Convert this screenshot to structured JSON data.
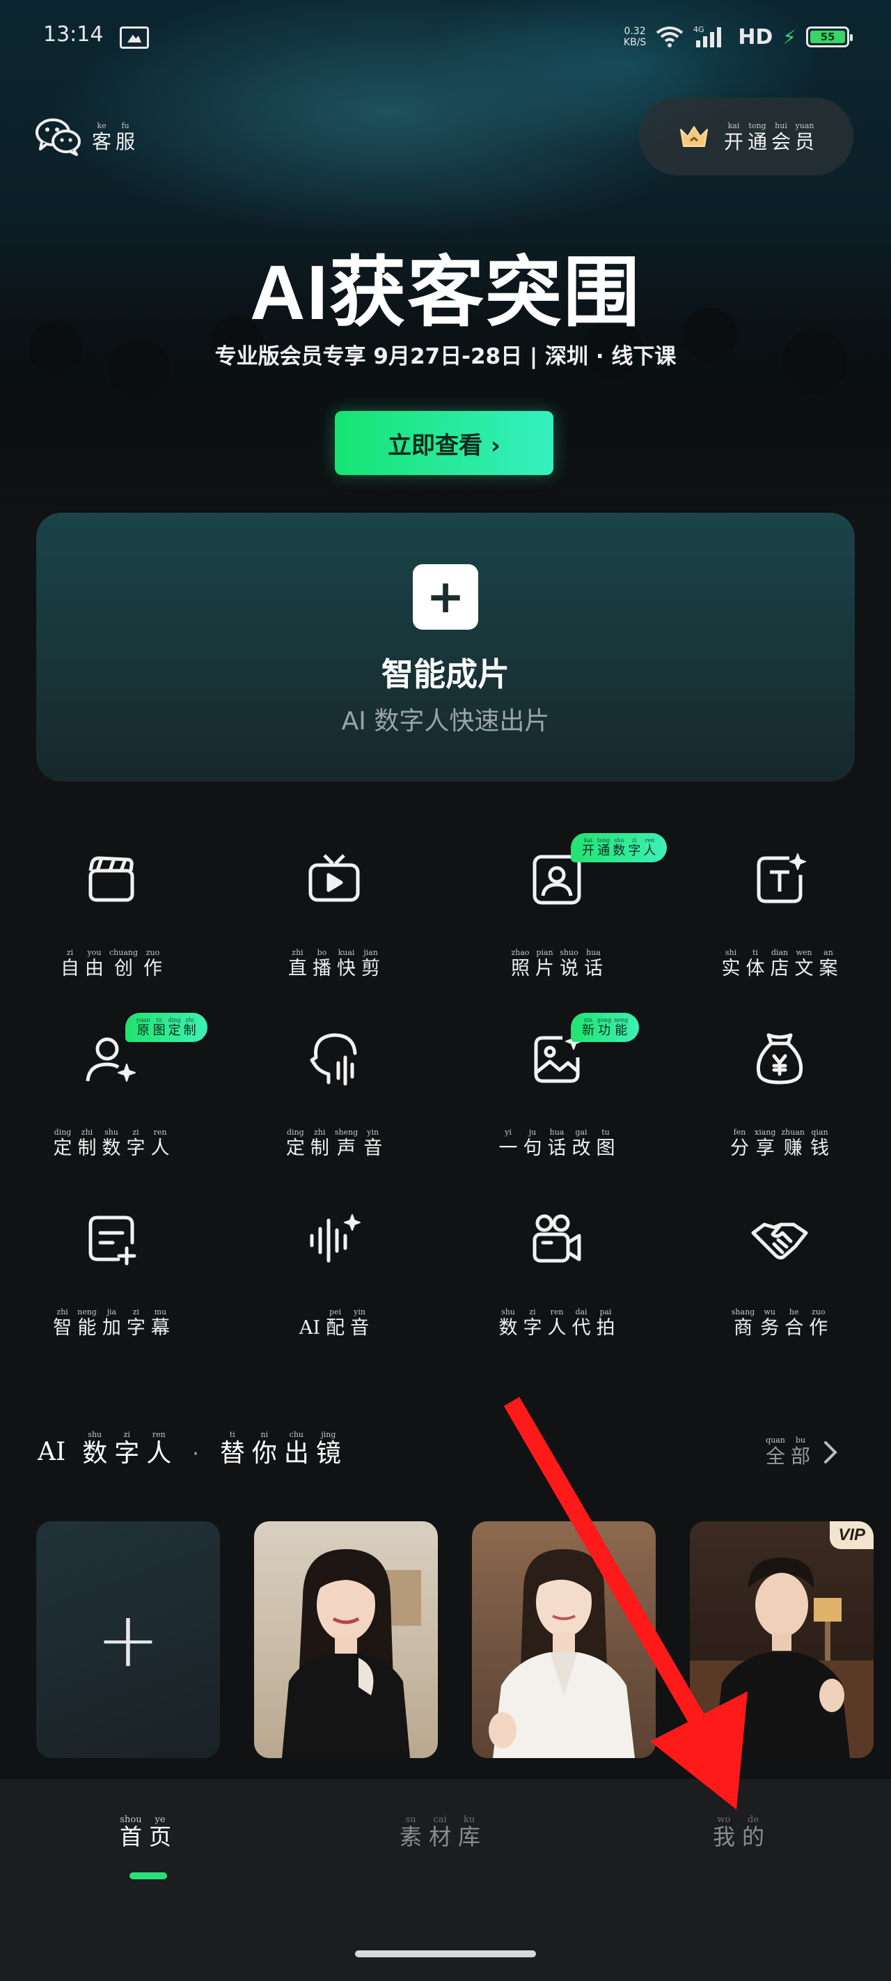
{
  "status_bar": {
    "time": "13:14",
    "net_speed_value": "0.32",
    "net_speed_unit": "KB/S",
    "network": "4G",
    "hd": "HD",
    "battery": "55"
  },
  "header": {
    "service": [
      {
        "py": "ke",
        "hz": "客"
      },
      {
        "py": "fu",
        "hz": "服"
      }
    ],
    "vip": [
      {
        "py": "kai",
        "hz": "开"
      },
      {
        "py": "tong",
        "hz": "通"
      },
      {
        "py": "hui",
        "hz": "会"
      },
      {
        "py": "yuan",
        "hz": "员"
      }
    ]
  },
  "banner": {
    "title": "AI获客突围",
    "subtitle": "专业版会员专享  9月27日-28日 | 深圳 · 线下课",
    "cta": "立即查看 ›"
  },
  "smart_card": {
    "plus": "+",
    "title": "智能成片",
    "subtitle": "AI 数字人快速出片"
  },
  "tools": [
    {
      "name": "free-create",
      "icon": "clapperboard-icon",
      "label": [
        {
          "py": "zi",
          "hz": "自"
        },
        {
          "py": "you",
          "hz": "由"
        },
        {
          "py": "chuang",
          "hz": "创"
        },
        {
          "py": "zuo",
          "hz": "作"
        }
      ]
    },
    {
      "name": "live-clip",
      "icon": "tv-play-icon",
      "label": [
        {
          "py": "zhi",
          "hz": "直"
        },
        {
          "py": "bo",
          "hz": "播"
        },
        {
          "py": "kuai",
          "hz": "快"
        },
        {
          "py": "jian",
          "hz": "剪"
        }
      ]
    },
    {
      "name": "photo-talk",
      "icon": "portrait-icon",
      "badge": [
        {
          "py": "kai",
          "hz": "开"
        },
        {
          "py": "tong",
          "hz": "通"
        },
        {
          "py": "shu",
          "hz": "数"
        },
        {
          "py": "zi",
          "hz": "字"
        },
        {
          "py": "ren",
          "hz": "人"
        }
      ],
      "label": [
        {
          "py": "zhao",
          "hz": "照"
        },
        {
          "py": "pian",
          "hz": "片"
        },
        {
          "py": "shuo",
          "hz": "说"
        },
        {
          "py": "hua",
          "hz": "话"
        }
      ]
    },
    {
      "name": "store-copy",
      "icon": "text-sparkle-icon",
      "label": [
        {
          "py": "shi",
          "hz": "实"
        },
        {
          "py": "ti",
          "hz": "体"
        },
        {
          "py": "dian",
          "hz": "店"
        },
        {
          "py": "wen",
          "hz": "文"
        },
        {
          "py": "an",
          "hz": "案"
        }
      ]
    },
    {
      "name": "custom-avatar",
      "icon": "user-sparkle-icon",
      "badge": [
        {
          "py": "yuan",
          "hz": "原"
        },
        {
          "py": "tu",
          "hz": "图"
        },
        {
          "py": "ding",
          "hz": "定"
        },
        {
          "py": "zhi",
          "hz": "制"
        }
      ],
      "label": [
        {
          "py": "ding",
          "hz": "定"
        },
        {
          "py": "zhi",
          "hz": "制"
        },
        {
          "py": "shu",
          "hz": "数"
        },
        {
          "py": "zi",
          "hz": "字"
        },
        {
          "py": "ren",
          "hz": "人"
        }
      ]
    },
    {
      "name": "custom-voice",
      "icon": "voice-head-icon",
      "label": [
        {
          "py": "ding",
          "hz": "定"
        },
        {
          "py": "zhi",
          "hz": "制"
        },
        {
          "py": "sheng",
          "hz": "声"
        },
        {
          "py": "yin",
          "hz": "音"
        }
      ]
    },
    {
      "name": "edit-image",
      "icon": "image-sparkle-icon",
      "badge": [
        {
          "py": "xin",
          "hz": "新"
        },
        {
          "py": "gong",
          "hz": "功"
        },
        {
          "py": "neng",
          "hz": "能"
        }
      ],
      "label": [
        {
          "py": "yi",
          "hz": "一"
        },
        {
          "py": "ju",
          "hz": "句"
        },
        {
          "py": "hua",
          "hz": "话"
        },
        {
          "py": "gai",
          "hz": "改"
        },
        {
          "py": "tu",
          "hz": "图"
        }
      ]
    },
    {
      "name": "share-earn",
      "icon": "money-bag-icon",
      "label": [
        {
          "py": "fen",
          "hz": "分"
        },
        {
          "py": "xiang",
          "hz": "享"
        },
        {
          "py": "zhuan",
          "hz": "赚"
        },
        {
          "py": "qian",
          "hz": "钱"
        }
      ]
    },
    {
      "name": "add-subtitle",
      "icon": "subtitle-add-icon",
      "label": [
        {
          "py": "zhi",
          "hz": "智"
        },
        {
          "py": "neng",
          "hz": "能"
        },
        {
          "py": "jia",
          "hz": "加"
        },
        {
          "py": "zi",
          "hz": "字"
        },
        {
          "py": "mu",
          "hz": "幕"
        }
      ]
    },
    {
      "name": "ai-dubbing",
      "icon": "waveform-sparkle-icon",
      "label": [
        {
          "py": "",
          "hz": "AI"
        },
        {
          "py": "pei",
          "hz": "配"
        },
        {
          "py": "yin",
          "hz": "音"
        }
      ]
    },
    {
      "name": "avatar-shoot",
      "icon": "video-camera-icon",
      "label": [
        {
          "py": "shu",
          "hz": "数"
        },
        {
          "py": "zi",
          "hz": "字"
        },
        {
          "py": "ren",
          "hz": "人"
        },
        {
          "py": "dai",
          "hz": "代"
        },
        {
          "py": "pai",
          "hz": "拍"
        }
      ]
    },
    {
      "name": "business",
      "icon": "handshake-icon",
      "label": [
        {
          "py": "shang",
          "hz": "商"
        },
        {
          "py": "wu",
          "hz": "务"
        },
        {
          "py": "he",
          "hz": "合"
        },
        {
          "py": "zuo",
          "hz": "作"
        }
      ]
    }
  ],
  "digital_humans": {
    "title_prefix": "AI",
    "title_a": [
      {
        "py": "shu",
        "hz": "数"
      },
      {
        "py": "zi",
        "hz": "字"
      },
      {
        "py": "ren",
        "hz": "人"
      }
    ],
    "dot": "·",
    "title_b": [
      {
        "py": "ti",
        "hz": "替"
      },
      {
        "py": "ni",
        "hz": "你"
      },
      {
        "py": "chu",
        "hz": "出"
      },
      {
        "py": "jing",
        "hz": "镜"
      }
    ],
    "all": [
      {
        "py": "quan",
        "hz": "全"
      },
      {
        "py": "bu",
        "hz": "部"
      }
    ],
    "add": "+",
    "vip_tag": "VIP"
  },
  "bottom_nav": {
    "home": [
      {
        "py": "shou",
        "hz": "首"
      },
      {
        "py": "ye",
        "hz": "页"
      }
    ],
    "library": [
      {
        "py": "su",
        "hz": "素"
      },
      {
        "py": "cai",
        "hz": "材"
      },
      {
        "py": "ku",
        "hz": "库"
      }
    ],
    "mine": [
      {
        "py": "wo",
        "hz": "我"
      },
      {
        "py": "de",
        "hz": "的"
      }
    ]
  },
  "colors": {
    "accent": "#21e36f",
    "background": "#111213",
    "arrow": "#ff1a1a"
  }
}
